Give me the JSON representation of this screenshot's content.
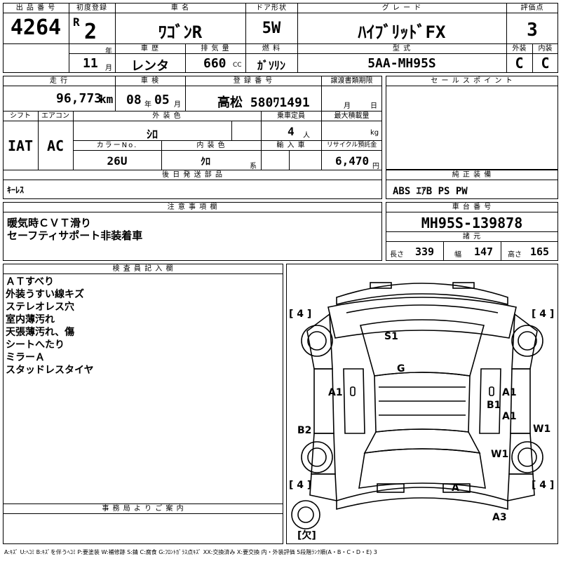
{
  "header": {
    "lot_label": "出 品 番 号",
    "lot_no": "4264",
    "first_reg_label": "初度登録",
    "era": "R",
    "year": "2",
    "year_unit": "年",
    "month": "11",
    "month_unit": "月",
    "car_name_label": "車 名",
    "car_name": "ﾜｺﾞﾝR",
    "door_label": "ドア形状",
    "door": "5W",
    "grade_label": "グ レ ー ド",
    "grade": "ﾊｲﾌﾞﾘｯﾄﾞFX",
    "score_label": "評価点",
    "score": "3",
    "history_label": "車 歴",
    "history": "レンタ",
    "displacement_label": "排 気 量",
    "displacement": "660",
    "displacement_unit": "CC",
    "fuel_label": "燃 料",
    "fuel": "ｶﾞｿﾘﾝ",
    "model_label": "型 式",
    "model": "5AA-MH95S",
    "exterior_label": "外装",
    "exterior": "C",
    "interior_label": "内装",
    "interior": "C"
  },
  "details": {
    "mileage_label": "走 行",
    "mileage": "96,773",
    "mileage_unit": "km",
    "inspection_label": "車 検",
    "insp_year": "08",
    "insp_year_unit": "年",
    "insp_month": "05",
    "insp_month_unit": "月",
    "plate_label": "登 録 番 号",
    "plate": "高松 580ﾜ1491",
    "transfer_label": "譲渡書類期限",
    "transfer_month": "月",
    "transfer_day": "日",
    "shift_label": "シフト",
    "shift": "IAT",
    "ac_label": "エアコン",
    "ac": "AC",
    "color_label": "外 装 色",
    "color": "ｼﾛ",
    "capacity_label": "乗車定員",
    "capacity": "4",
    "capacity_unit": "人",
    "load_label": "最大積載量",
    "load_unit": "kg",
    "colorno_label": "カラーNo.",
    "colorno": "26U",
    "intcolor_label": "内 装 色",
    "intcolor": "ｸﾛ",
    "intcolor_unit": "系",
    "import_label": "輸 入 車",
    "recycle_label": "リサイクル預託金",
    "recycle": "6,470",
    "recycle_unit": "円",
    "later_label": "後 日 発 送 部 品",
    "later": "ｷｰﾚｽ"
  },
  "sales": {
    "label": "セ ー ル ス ポ イ ン ト"
  },
  "equipment": {
    "label": "純 正 装 備",
    "value": "ABS ｴｱB PS PW"
  },
  "notes": {
    "label": "注 意 事 項 欄",
    "lines": [
      "暖気時ＣＶＴ滑り",
      "セーフティサポート非装着車"
    ]
  },
  "chassis": {
    "label": "車 台 番 号",
    "value": "MH95S-139878",
    "specs_label": "諸 元",
    "length_label": "長さ",
    "length": "339",
    "width_label": "幅",
    "width": "147",
    "height_label": "高さ",
    "height": "165"
  },
  "inspector": {
    "label": "検 査 員 記 入 欄",
    "lines": [
      "ＡＴすべり",
      "外装うすい線キズ",
      "ステレオレス穴",
      "室内薄汚れ",
      "天張薄汚れ、傷",
      "シートへたり",
      "ミラーＡ",
      "スタッドレスタイヤ"
    ]
  },
  "office": {
    "label": "事 務 局 よ り ご 案 内"
  },
  "diagram": {
    "tire_fl": "[ 4 ]",
    "tire_fr": "[ 4 ]",
    "tire_rl": "[ 4 ]",
    "tire_rr": "[ 4 ]",
    "spare": "[欠]",
    "marks": {
      "s1": "S1",
      "g": "G",
      "a1_left": "A1",
      "a1_right_top": "A1",
      "b1": "B1",
      "a1_right_bottom": "A1",
      "b2": "B2",
      "w1_right": "W1",
      "w1": "W1",
      "a_rear": "A",
      "a3": "A3"
    }
  },
  "legend": "A:ｷｽﾞ U:ﾍｺﾐ B:ｷｽﾞを伴うﾍｺﾐ P:要塗装 W:補修跡 S:錆 C:腐食 G:ﾌﾛﾝﾄｶﾞﾗｽ点ｷｽﾞ XX:交換済み X:要交換 内・外装評価 5段階ﾗﾝｸ順(A・B・C・D・E) 3"
}
